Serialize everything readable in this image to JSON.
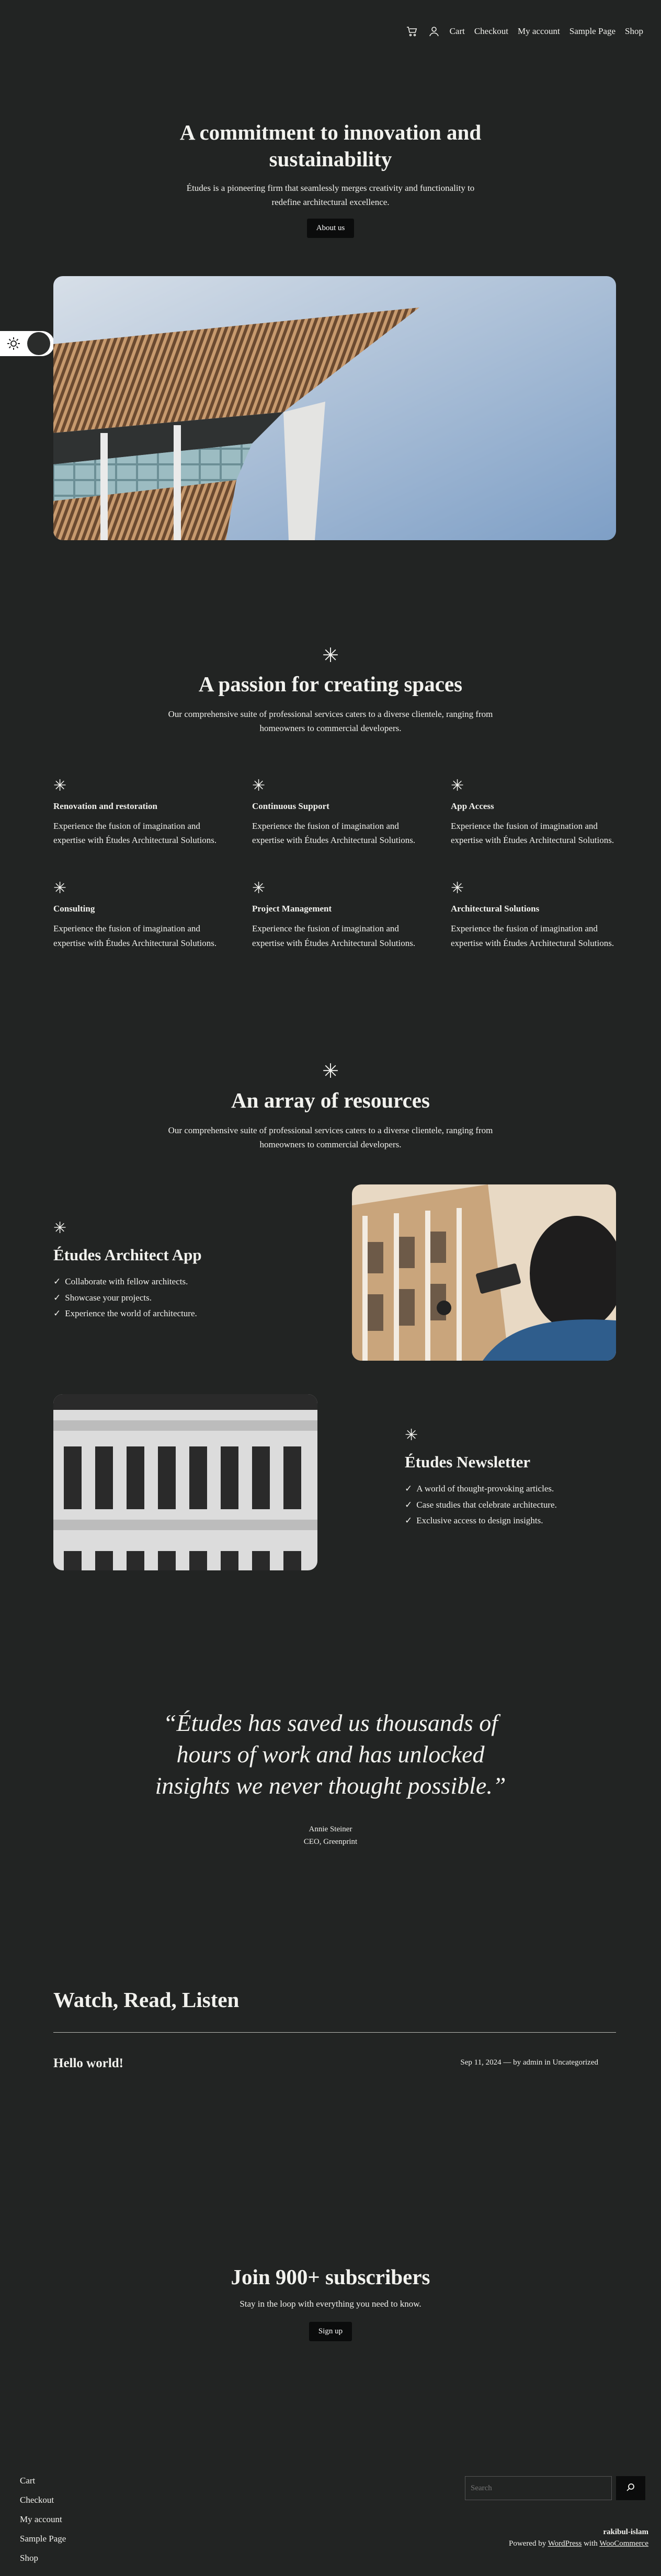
{
  "nav": {
    "cart_icon": "cart-icon",
    "account_icon": "user-icon",
    "links": [
      "Cart",
      "Checkout",
      "My account",
      "Sample Page",
      "Shop"
    ]
  },
  "theme_toggle": {
    "icon": "sun-icon"
  },
  "hero": {
    "title_line1": "A commitment to innovation and",
    "title_line2": "sustainability",
    "subtitle_line1": "Études is a pioneering firm that seamlessly merges creativity and functionality to",
    "subtitle_line2": "redefine architectural excellence.",
    "button": "About us",
    "image": "building-architecture-photo"
  },
  "services": {
    "title": "A passion for creating spaces",
    "subtitle_line1": "Our comprehensive suite of professional services caters to a diverse clientele, ranging from",
    "subtitle_line2": "homeowners to commercial developers.",
    "items": [
      {
        "title": "Renovation and restoration",
        "line1": "Experience the fusion of imagination and",
        "line2": "expertise with Études Architectural Solutions."
      },
      {
        "title": "Continuous Support",
        "line1": "Experience the fusion of imagination and",
        "line2": "expertise with Études Architectural Solutions."
      },
      {
        "title": "App Access",
        "line1": "Experience the fusion of imagination and",
        "line2": "expertise with Études Architectural Solutions."
      },
      {
        "title": "Consulting",
        "line1": "Experience the fusion of imagination and",
        "line2": "expertise with Études Architectural Solutions."
      },
      {
        "title": "Project Management",
        "line1": "Experience the fusion of imagination and",
        "line2": "expertise with Études Architectural Solutions."
      },
      {
        "title": "Architectural Solutions",
        "line1": "Experience the fusion of imagination and",
        "line2": "expertise with Études Architectural Solutions."
      }
    ]
  },
  "resources": {
    "title": "An array of resources",
    "subtitle_line1": "Our comprehensive suite of professional services caters to a diverse clientele, ranging from",
    "subtitle_line2": "homeowners to commercial developers.",
    "app": {
      "title": "Études Architect App",
      "items": [
        "Collaborate with fellow architects.",
        "Showcase your projects.",
        "Experience the world of architecture."
      ],
      "image": "woman-photographing-building-photo"
    },
    "newsletter": {
      "title": "Études Newsletter",
      "items": [
        "A world of thought-provoking articles.",
        "Case studies that celebrate architecture.",
        "Exclusive access to design insights."
      ],
      "image": "building-facade-photo"
    }
  },
  "testimonial": {
    "line1": "“Études has saved us thousands of",
    "line2": "hours of work and has unlocked",
    "line3": "insights we never thought possible.”",
    "name": "Annie Steiner",
    "role": "CEO, Greenprint"
  },
  "posts": {
    "title": "Watch, Read, Listen",
    "items": [
      {
        "title": "Hello world!",
        "date": "Sep 11, 2024",
        "sep": " — by ",
        "author": "admin",
        "in": " in ",
        "category": "Uncategorized"
      }
    ]
  },
  "subscribe": {
    "title": "Join 900+ subscribers",
    "subtitle": "Stay in the loop with everything you need to know.",
    "button": "Sign up"
  },
  "footer": {
    "links": [
      "Cart",
      "Checkout",
      "My account",
      "Sample Page",
      "Shop"
    ],
    "search_placeholder": "Search",
    "search_icon": "search-icon",
    "site_name": "rakibul-islam",
    "powered_prefix": "Powered by ",
    "wordpress": "WordPress",
    "with": " with ",
    "woocommerce": "WooCommerce"
  }
}
